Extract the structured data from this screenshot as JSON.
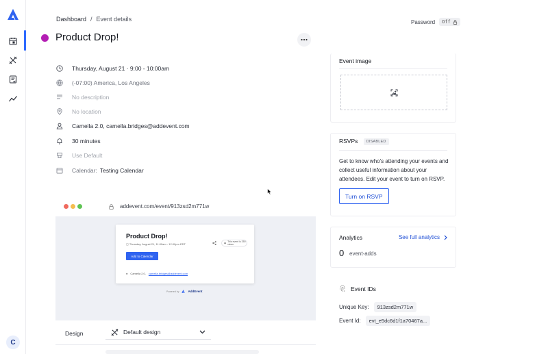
{
  "sidebar": {
    "logo": "addevent-logo-icon",
    "items": [
      {
        "icon": "calendar-icon"
      },
      {
        "icon": "design-tools-icon"
      },
      {
        "icon": "rsvp-list-icon"
      },
      {
        "icon": "analytics-trend-icon"
      }
    ],
    "avatar_initial": "C",
    "accent": "#2f6bff"
  },
  "breadcrumb": {
    "items": [
      "Dashboard",
      "Event details"
    ],
    "separator": "/"
  },
  "password": {
    "label": "Password",
    "state": "Off"
  },
  "event": {
    "title": "Product Drop!",
    "color": "#b41eb4",
    "more_icon": "more-dots-icon",
    "details": {
      "datetime": "Thursday, August 21 · 9:00 - 10:00am",
      "timezone": "(-07:00) America, Los Angeles",
      "description": "No description",
      "location": "No location",
      "organizer": "Camella 2.0, camella.bridges@addevent.com",
      "reminder": "30 minutes",
      "template": "Use Default",
      "calendar_label": "Calendar:",
      "calendar_value": "Testing Calendar"
    }
  },
  "preview": {
    "url": "addevent.com/event/913zsd2m771w",
    "card": {
      "title": "Product Drop!",
      "date": "Thursday, August 21, 11:00am - 12:00pm EDT",
      "views": "This event is 250 views",
      "add_button": "Add to Calendar",
      "organizer_name": "Camella 2.0,",
      "organizer_email": "camella.bridges@addevent.com"
    },
    "powered_by": "Powered by",
    "brand": "AddEvent"
  },
  "design": {
    "label": "Design",
    "selected": "Default design"
  },
  "event_image": {
    "title": "Event image",
    "upload_icon": "image-upload-icon"
  },
  "rsvps": {
    "title": "RSVPs",
    "badge": "DISABLED",
    "text": "Get to know who's attending your events and collect useful information about your attendees. Edit your event to turn on RSVP.",
    "button": "Turn on RSVP"
  },
  "analytics": {
    "title": "Analytics",
    "link": "See full analytics",
    "count": "0",
    "count_label": "event-adds"
  },
  "event_ids": {
    "title": "Event IDs",
    "unique_key_label": "Unique Key:",
    "unique_key": "913zsd2m771w",
    "event_id_label": "Event Id:",
    "event_id": "evt_e5dc6d1f1a70467a..."
  }
}
